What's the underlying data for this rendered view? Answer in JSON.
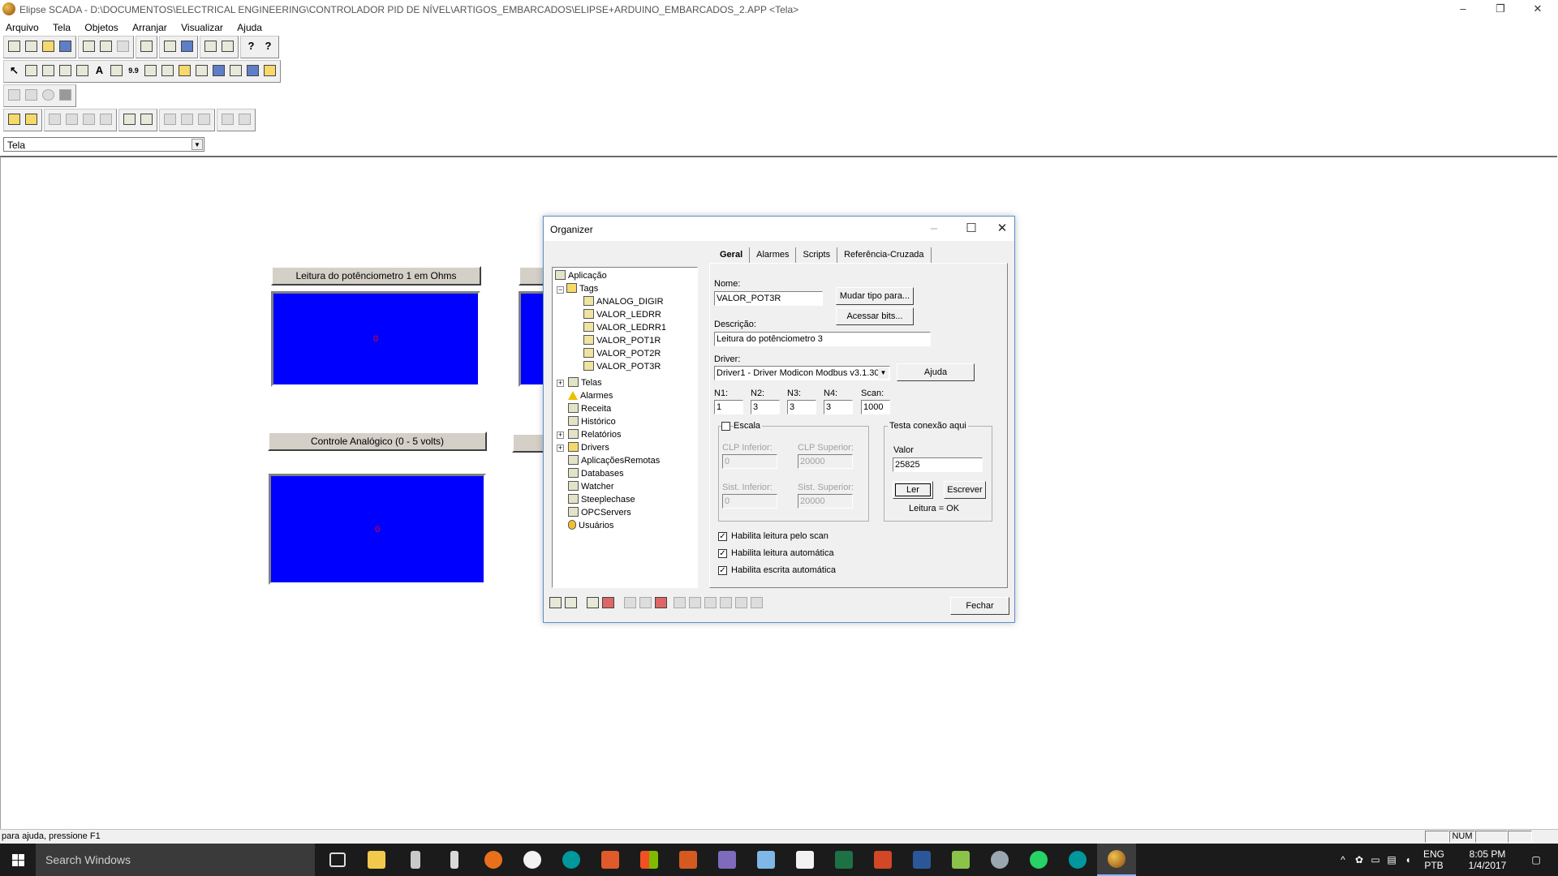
{
  "window": {
    "title": "Elipse SCADA - D:\\DOCUMENTOS\\ELECTRICAL ENGINEERING\\CONTROLADOR PID DE NÍVEL\\ARTIGOS_EMBARCADOS\\ELIPSE+ARDUINO_EMBARCADOS_2.APP <Tela>",
    "minimize": "–",
    "restore": "❐",
    "close": "✕"
  },
  "menu": [
    "Arquivo",
    "Tela",
    "Objetos",
    "Arranjar",
    "Visualizar",
    "Ajuda"
  ],
  "screen_combo": {
    "value": "Tela"
  },
  "canvas": {
    "label1": "Leitura do potênciometro 1 em Ohms",
    "display1_value": "0",
    "label2": "Controle Analógico (0 - 5 volts)",
    "display2_value": "0"
  },
  "dialog": {
    "title": "Organizer",
    "tree": {
      "root": "Aplicação",
      "tags_label": "Tags",
      "tags": [
        "ANALOG_DIGIR",
        "VALOR_LEDRR",
        "VALOR_LEDRR1",
        "VALOR_POT1R",
        "VALOR_POT2R",
        "VALOR_POT3R"
      ],
      "others": [
        "Telas",
        "Alarmes",
        "Receita",
        "Histórico",
        "Relatórios",
        "Drivers",
        "AplicaçõesRemotas",
        "Databases",
        "Watcher",
        "Steeplechase",
        "OPCServers",
        "Usuários"
      ]
    },
    "tabs": [
      "Geral",
      "Alarmes",
      "Scripts",
      "Referência-Cruzada"
    ],
    "nome_label": "Nome:",
    "nome_value": "VALOR_POT3R",
    "mudar_tipo": "Mudar tipo para...",
    "acessar_bits": "Acessar bits...",
    "descricao_label": "Descrição:",
    "descricao_value": "Leitura do potênciometro 3",
    "driver_label": "Driver:",
    "driver_value": "Driver1 - Driver Modicon Modbus v3.1.30",
    "ajuda": "Ajuda",
    "params": [
      {
        "label": "N1:",
        "value": "1"
      },
      {
        "label": "N2:",
        "value": "3"
      },
      {
        "label": "N3:",
        "value": "3"
      },
      {
        "label": "N4:",
        "value": "3"
      },
      {
        "label": "Scan:",
        "value": "1000"
      }
    ],
    "escala": {
      "label": "Escala",
      "checked": false,
      "clp_inferior_label": "CLP Inferior:",
      "clp_inferior": "0",
      "clp_superior_label": "CLP Superior:",
      "clp_superior": "20000",
      "sist_inferior_label": "Sist. Inferior:",
      "sist_inferior": "0",
      "sist_superior_label": "Sist. Superior:",
      "sist_superior": "20000"
    },
    "teste": {
      "title": "Testa conexão aqui",
      "valor_label": "Valor",
      "valor": "25825",
      "ler": "Ler",
      "escrever": "Escrever",
      "status": "Leitura = OK"
    },
    "checks": [
      {
        "label": "Habilita leitura pelo scan",
        "checked": true
      },
      {
        "label": "Habilita leitura automática",
        "checked": true
      },
      {
        "label": "Habilita escrita automática",
        "checked": true
      }
    ],
    "fechar": "Fechar"
  },
  "statusbar": {
    "help": "para ajuda, pressione F1",
    "num": "NUM"
  },
  "taskbar": {
    "search": "Search Windows",
    "lang1": "ENG",
    "lang2": "PTB",
    "time": "8:05 PM",
    "date": "1/4/2017"
  },
  "colors": {
    "display_bg": "#0000ff",
    "display_text": "#ff0000",
    "dialog_border": "#5a8fcf",
    "taskbar": "#1b1b1b"
  }
}
